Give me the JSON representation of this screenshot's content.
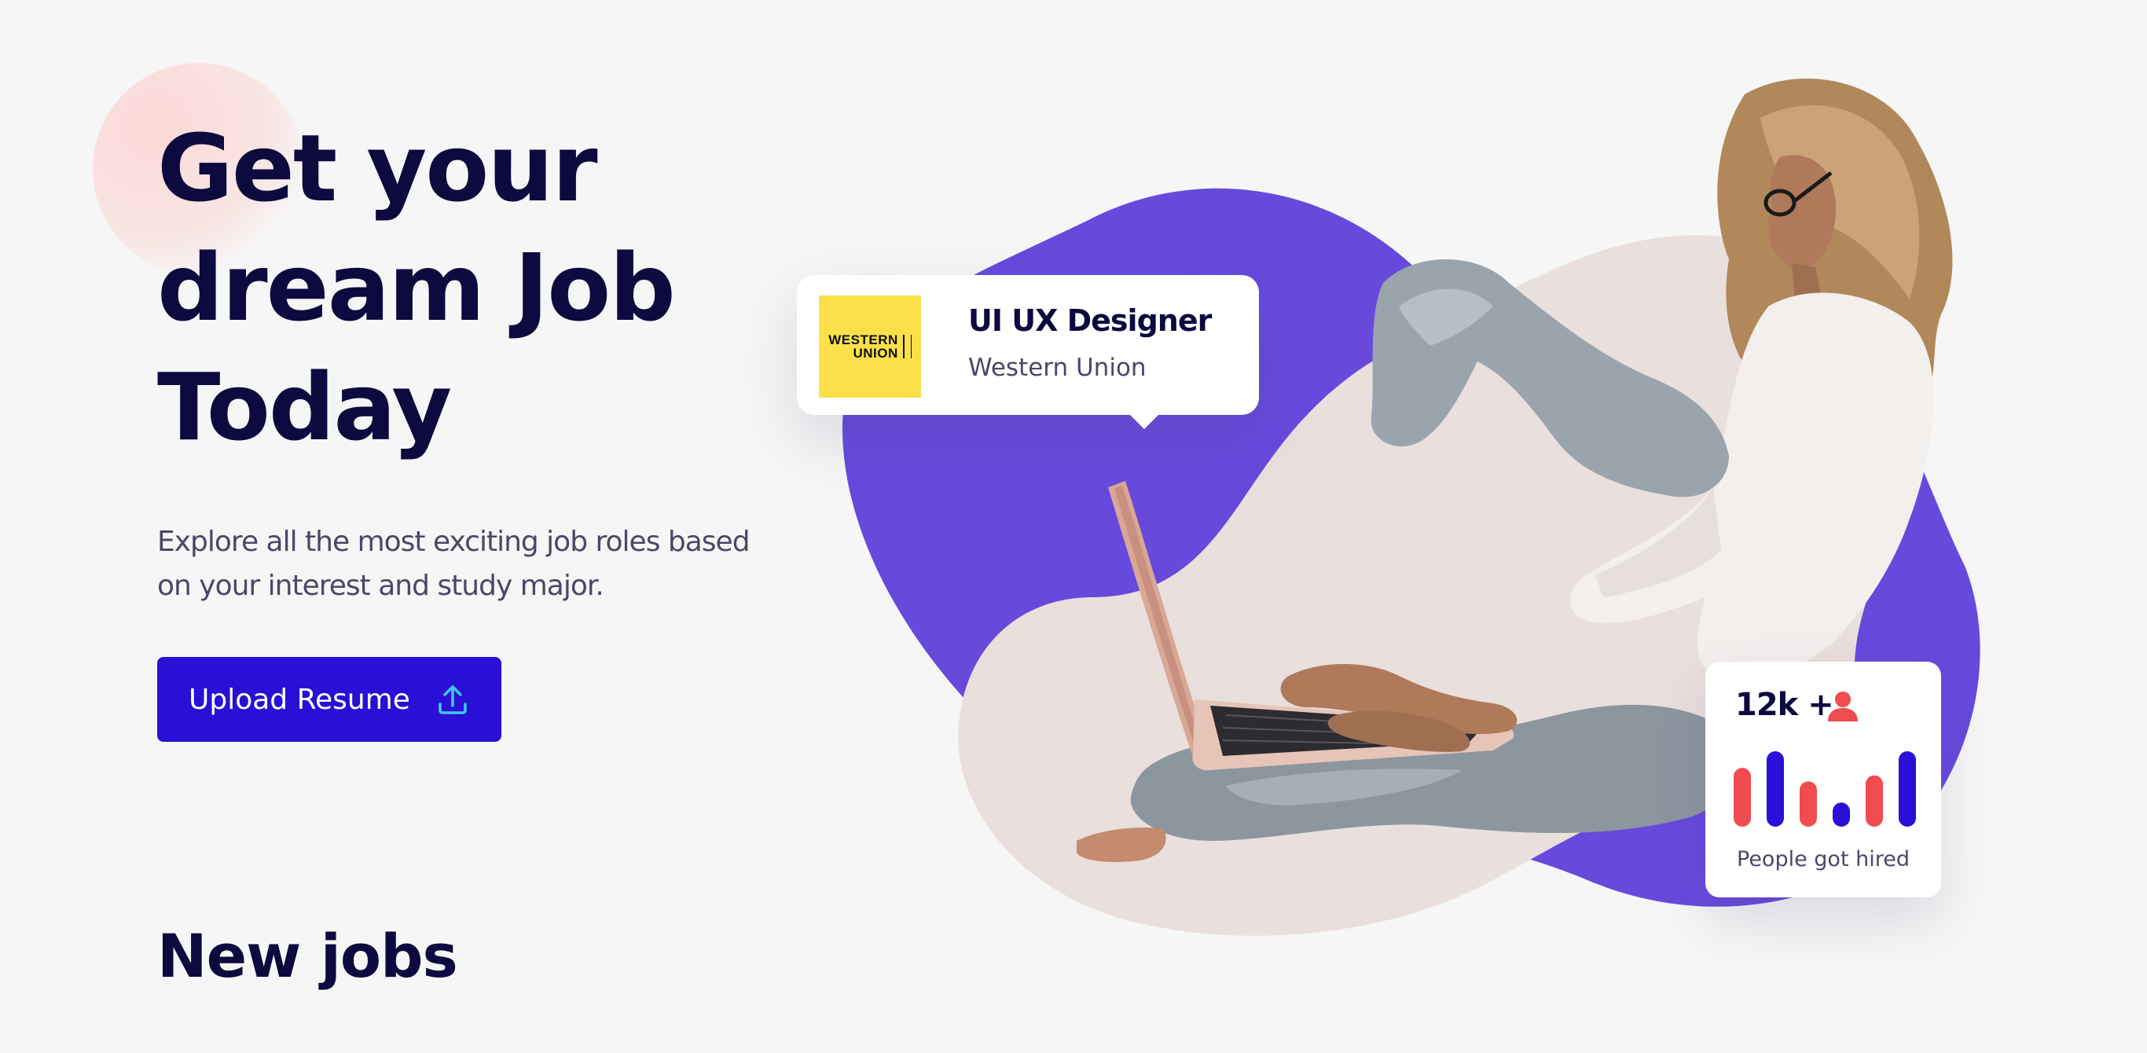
{
  "hero": {
    "title_lines": [
      "Get your",
      "dream Job",
      "Today"
    ],
    "description_lines": [
      "Explore all the most exciting job roles based",
      "on your interest and study major."
    ],
    "upload_button_label": "Upload Resume",
    "upload_icon": "upload-icon"
  },
  "job_card": {
    "logo_text_line1": "WESTERN",
    "logo_text_line2": "UNION",
    "title": "UI UX Designer",
    "company": "Western Union"
  },
  "stats_card": {
    "value": "12k +",
    "icon": "person-icon",
    "label": "People got hired",
    "bar_levels": [
      {
        "level": 0.78,
        "color": "#f04b4f"
      },
      {
        "level": 1.0,
        "color": "#2a0fd6"
      },
      {
        "level": 0.6,
        "color": "#f04b4f"
      },
      {
        "level": 0.32,
        "color": "#2a0fd6"
      },
      {
        "level": 0.68,
        "color": "#f04b4f"
      },
      {
        "level": 1.0,
        "color": "#2a0fd6"
      }
    ]
  },
  "new_jobs": {
    "title": "New jobs"
  },
  "colors": {
    "primary": "#2a0fd6",
    "heading": "#0c0a3e",
    "blob_purple": "#6749dc",
    "blob_beige": "#e9dfdc",
    "accent_red": "#f04b4f"
  }
}
